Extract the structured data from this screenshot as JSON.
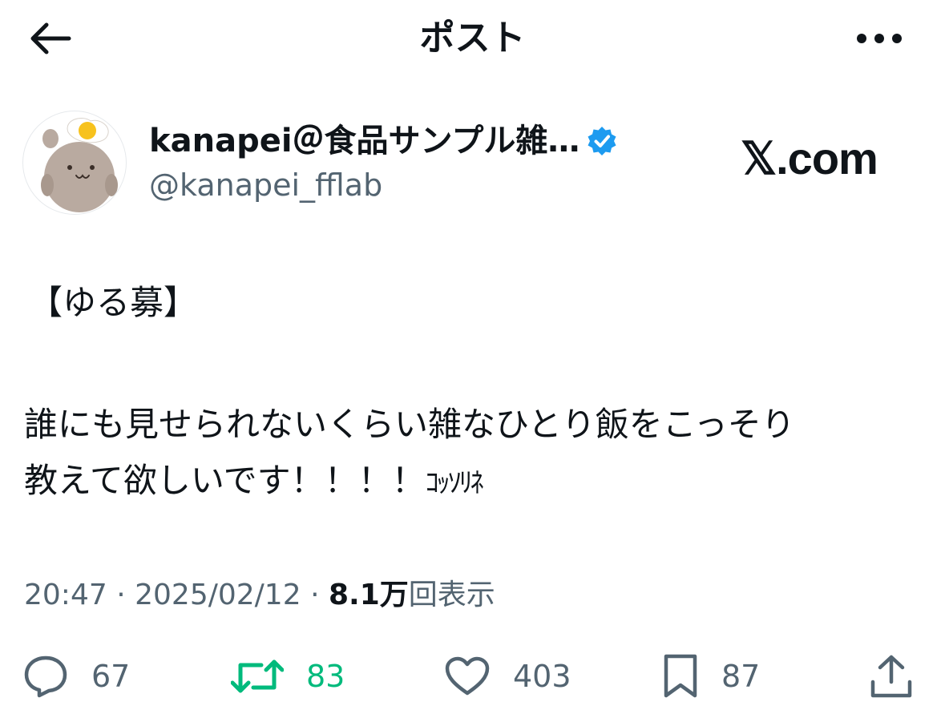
{
  "header": {
    "title": "ポスト",
    "back_icon": "arrow-left-icon",
    "more_icon": "more-horizontal-icon"
  },
  "author": {
    "display_name": "kanapei＠食品サンプル雑…",
    "handle": "@kanapei_fflab",
    "verified": true,
    "verified_color": "#1d9bf0"
  },
  "brand": {
    "text": "𝕏.com"
  },
  "post": {
    "line1": "【ゆる募】",
    "line2": "誰にも見せられないくらい雑なひとり飯をこっそり",
    "line3_main": "教えて欲しいです！！！！",
    "line3_small": "ｺｯｿﾘﾈ"
  },
  "meta": {
    "time": "20:47",
    "date": "2025/02/12",
    "views_count": "8.1万",
    "views_label": "回表示",
    "separator": "·"
  },
  "actions": {
    "replies": "67",
    "reposts": "83",
    "likes": "403",
    "bookmarks": "87"
  },
  "colors": {
    "text": "#0f1419",
    "secondary": "#536471",
    "repost_active": "#00ba7c"
  }
}
